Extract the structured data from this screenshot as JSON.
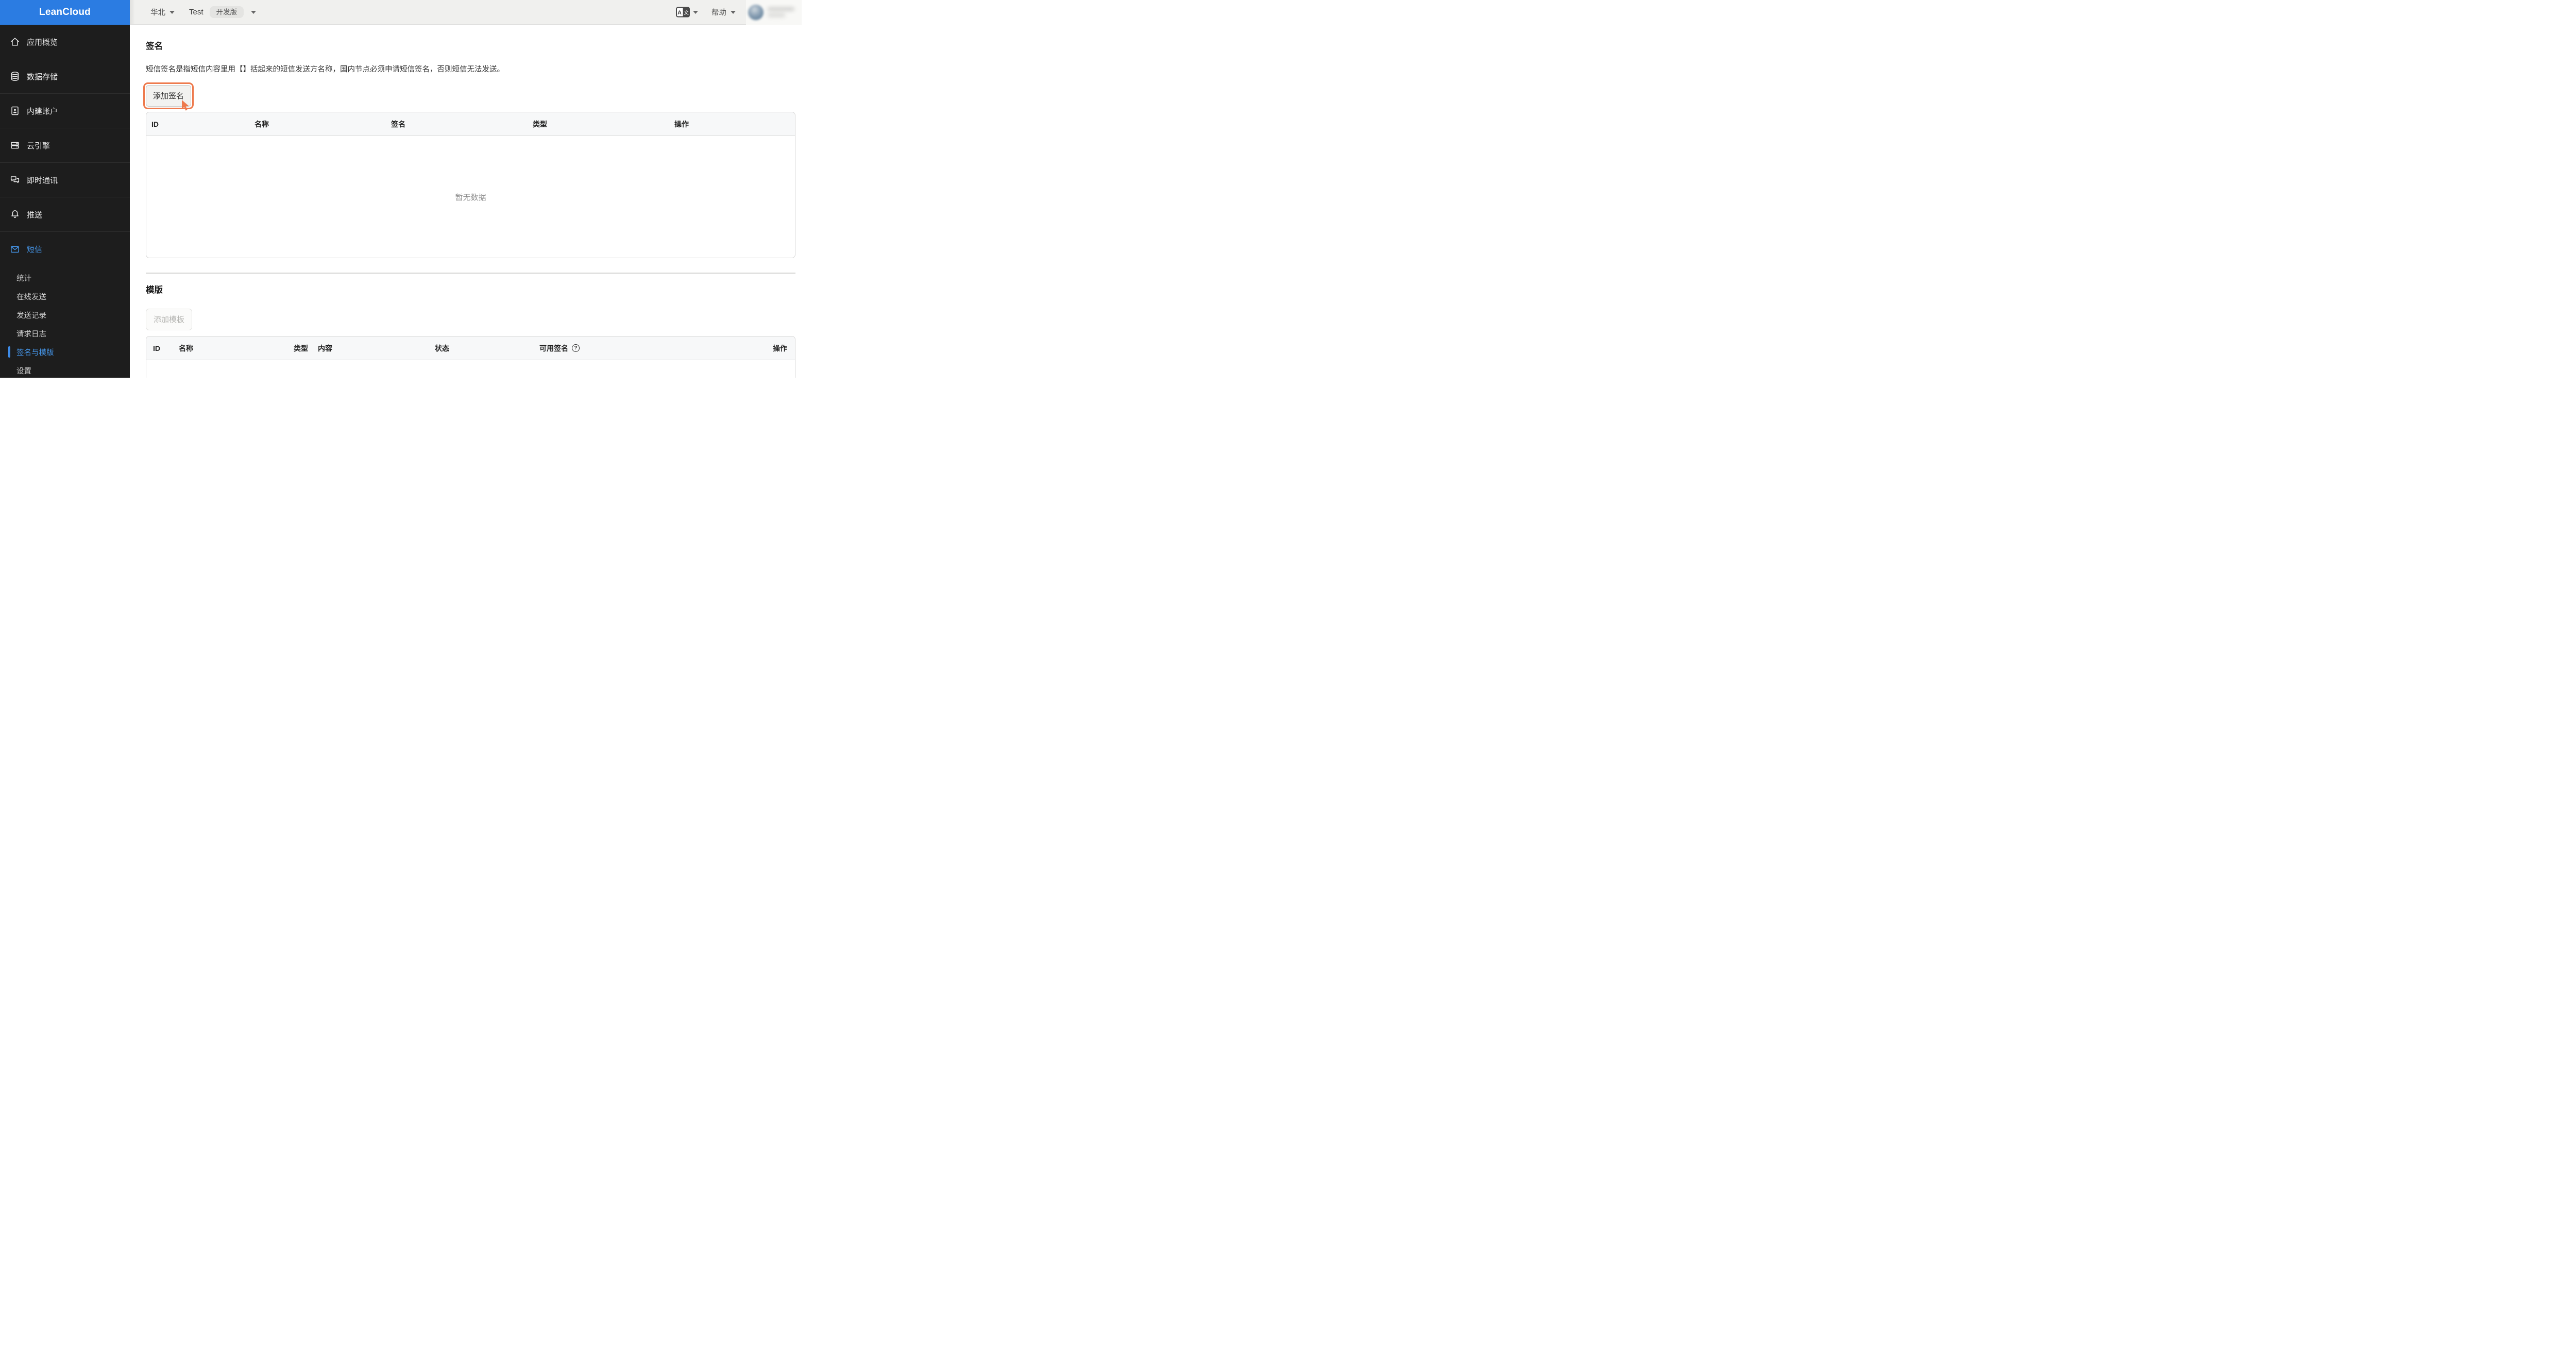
{
  "topbar": {
    "region_label": "华北",
    "app_name": "Test",
    "env_badge": "开发版",
    "help_label": "帮助"
  },
  "sidebar": {
    "logo": "LeanCloud",
    "items": [
      {
        "label": "应用概览",
        "icon": "home-icon"
      },
      {
        "label": "数据存储",
        "icon": "database-icon"
      },
      {
        "label": "内建账户",
        "icon": "id-card-icon"
      },
      {
        "label": "云引擎",
        "icon": "server-icon"
      },
      {
        "label": "即时通讯",
        "icon": "chat-icon"
      },
      {
        "label": "推送",
        "icon": "bell-icon"
      },
      {
        "label": "短信",
        "icon": "mail-icon",
        "active": true
      }
    ],
    "submenu": [
      {
        "label": "统计"
      },
      {
        "label": "在线发送"
      },
      {
        "label": "发送记录"
      },
      {
        "label": "请求日志"
      },
      {
        "label": "签名与模版",
        "active": true
      },
      {
        "label": "设置"
      }
    ]
  },
  "signature_section": {
    "title": "签名",
    "description": "短信签名是指短信内容里用【】括起来的短信发送方名称，国内节点必须申请短信签名，否则短信无法发送。",
    "add_button": "添加签名",
    "table_headers": [
      "ID",
      "名称",
      "签名",
      "类型",
      "操作"
    ],
    "empty_text": "暂无数据"
  },
  "template_section": {
    "title": "模版",
    "add_button": "添加模板",
    "table_headers": [
      "ID",
      "名称",
      "类型",
      "内容",
      "状态",
      "可用签名",
      "操作"
    ],
    "help_glyph": "?"
  },
  "colors": {
    "logo_blue": "#2b7ce2",
    "sidebar_active_blue": "#4596ea",
    "annotation_orange": "#ee7a4d",
    "sidebar_bg": "#1d1d1d",
    "topbar_bg": "#f0f0ee"
  }
}
